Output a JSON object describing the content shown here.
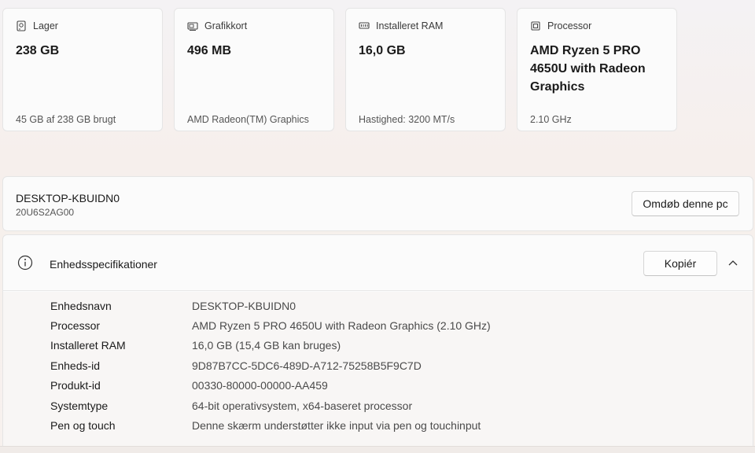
{
  "cards": [
    {
      "label": "Lager",
      "icon": "storage-icon",
      "value": "238 GB",
      "sub": "45 GB af 238 GB brugt"
    },
    {
      "label": "Grafikkort",
      "icon": "graphics-card-icon",
      "value": "496 MB",
      "sub": "AMD Radeon(TM) Graphics"
    },
    {
      "label": "Installeret RAM",
      "icon": "ram-icon",
      "value": "16,0 GB",
      "sub": "Hastighed: 3200 MT/s"
    },
    {
      "label": "Processor",
      "icon": "processor-icon",
      "value": "AMD Ryzen 5 PRO 4650U with Radeon Graphics",
      "sub": "2.10 GHz"
    }
  ],
  "device": {
    "name": "DESKTOP-KBUIDN0",
    "model": "20U6S2AG00",
    "rename_label": "Omdøb denne pc"
  },
  "specs": {
    "title": "Enhedsspecifikationer",
    "copy_label": "Kopiér",
    "rows": [
      {
        "key": "Enhedsnavn",
        "value": "DESKTOP-KBUIDN0"
      },
      {
        "key": "Processor",
        "value": "AMD Ryzen 5 PRO 4650U with Radeon Graphics (2.10 GHz)"
      },
      {
        "key": "Installeret RAM",
        "value": "16,0 GB (15,4 GB kan bruges)"
      },
      {
        "key": "Enheds-id",
        "value": "9D87B7CC-5DC6-489D-A712-75258B5F9C7D"
      },
      {
        "key": "Produkt-id",
        "value": "00330-80000-00000-AA459"
      },
      {
        "key": "Systemtype",
        "value": "64-bit operativsystem, x64-baseret processor"
      },
      {
        "key": "Pen og touch",
        "value": "Denne skærm understøtter ikke input via pen og touchinput"
      }
    ]
  }
}
